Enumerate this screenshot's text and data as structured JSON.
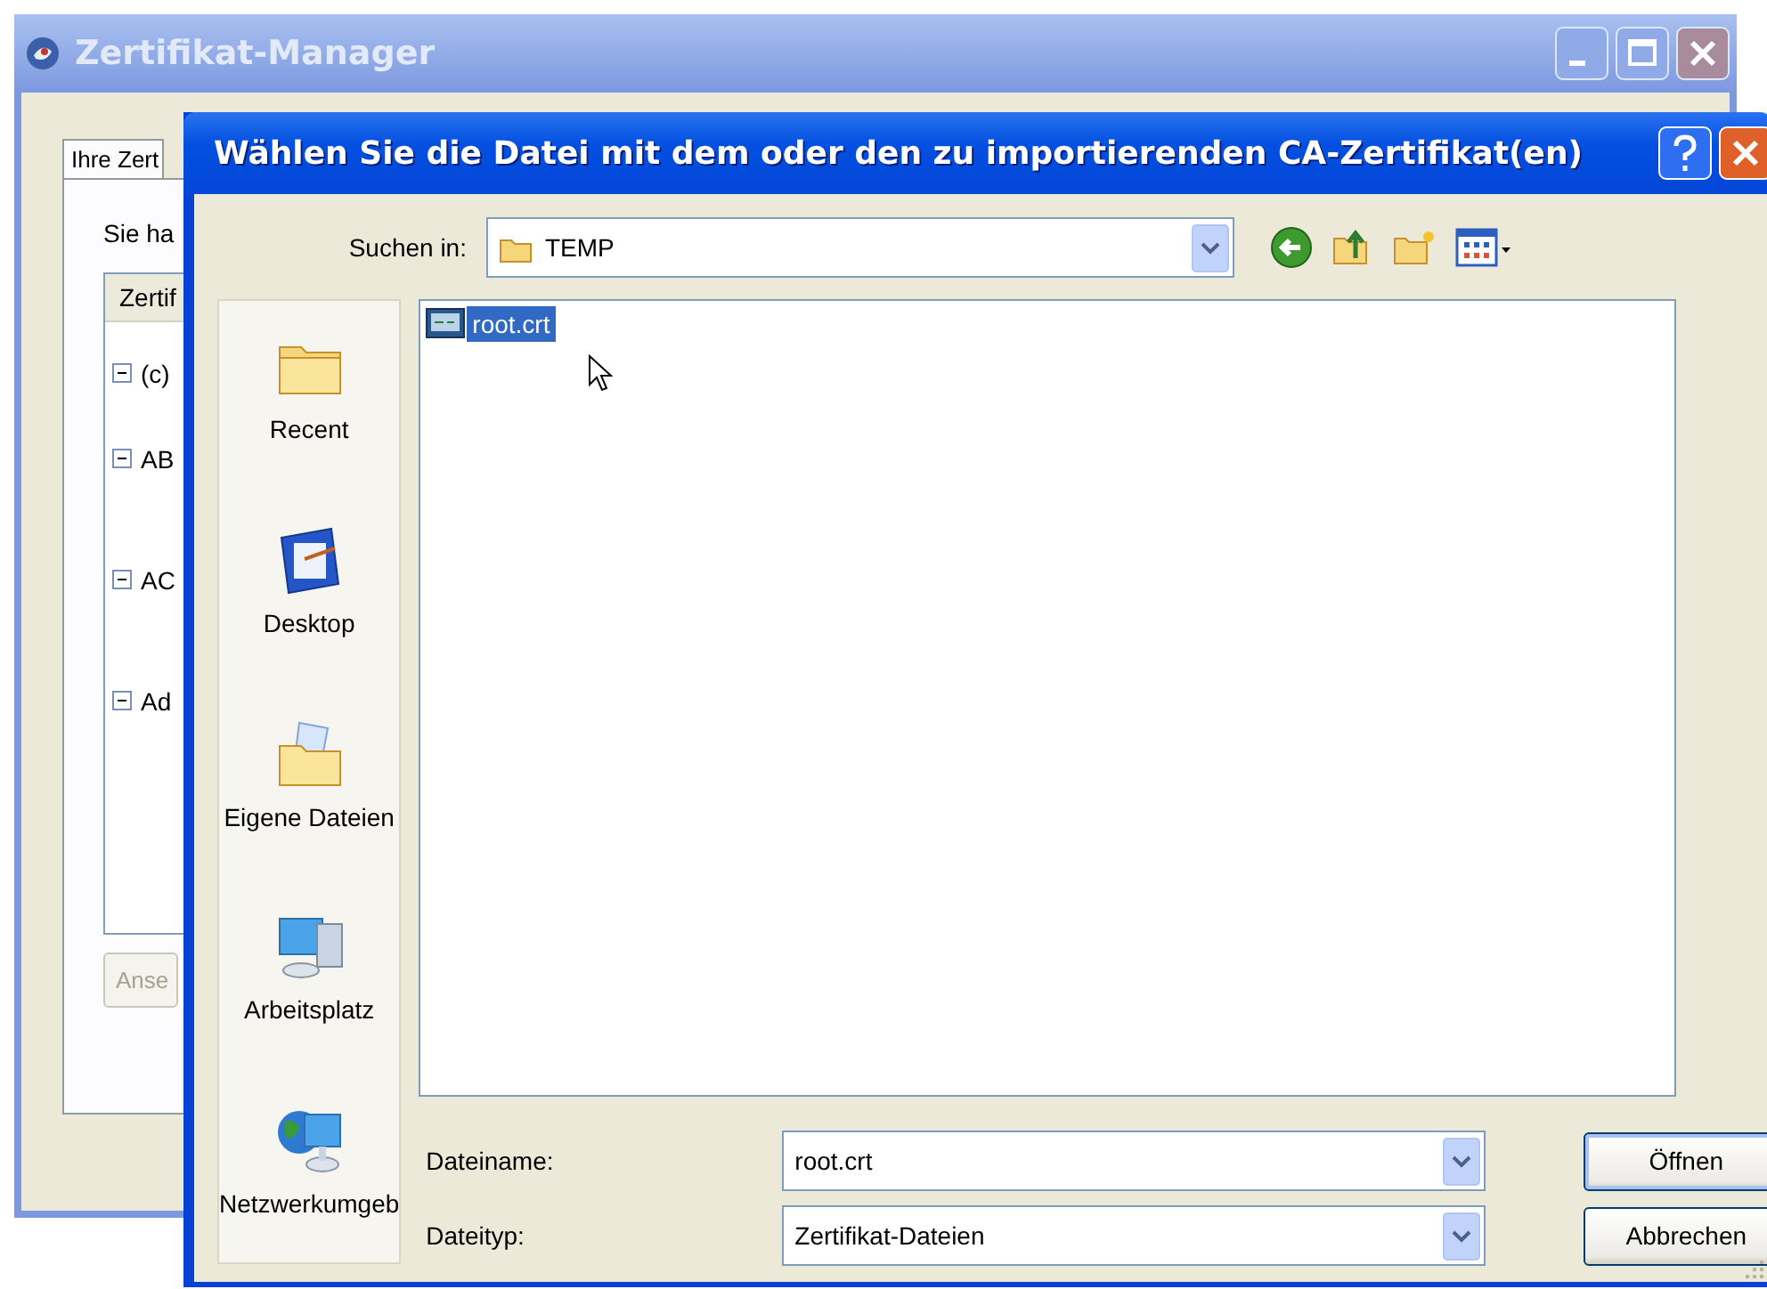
{
  "background_window": {
    "title": "Zertifikat-Manager",
    "tab": "Ihre Zert",
    "text": "Sie ha",
    "tree": {
      "column": "Zertif",
      "rows": [
        {
          "label": "(c)",
          "expanded": true
        },
        {
          "label": "AB",
          "expanded": true
        },
        {
          "label": "AC",
          "expanded": true
        },
        {
          "label": "Ad",
          "expanded": true
        }
      ]
    },
    "button": {
      "label": "Anse",
      "disabled": true
    }
  },
  "dialog": {
    "title": "Wählen Sie die Datei mit dem oder den zu importierenden CA-Zertifikat(en)",
    "look_in": {
      "label": "Suchen in:",
      "value": "TEMP"
    },
    "places": [
      {
        "label": "Recent",
        "kind": "recent"
      },
      {
        "label": "Desktop",
        "kind": "desktop"
      },
      {
        "label": "Eigene Dateien",
        "kind": "documents"
      },
      {
        "label": "Arbeitsplatz",
        "kind": "computer"
      },
      {
        "label": "Netzwerkumgeb",
        "kind": "network"
      }
    ],
    "files": [
      {
        "name": "root.crt",
        "selected": true
      }
    ],
    "file_name": {
      "label": "Dateiname:",
      "value": "root.crt"
    },
    "file_type": {
      "label": "Dateityp:",
      "value": "Zertifikat-Dateien"
    },
    "buttons": [
      {
        "label": "Öffnen",
        "default": true
      },
      {
        "label": "Abbrechen",
        "default": false
      }
    ]
  }
}
